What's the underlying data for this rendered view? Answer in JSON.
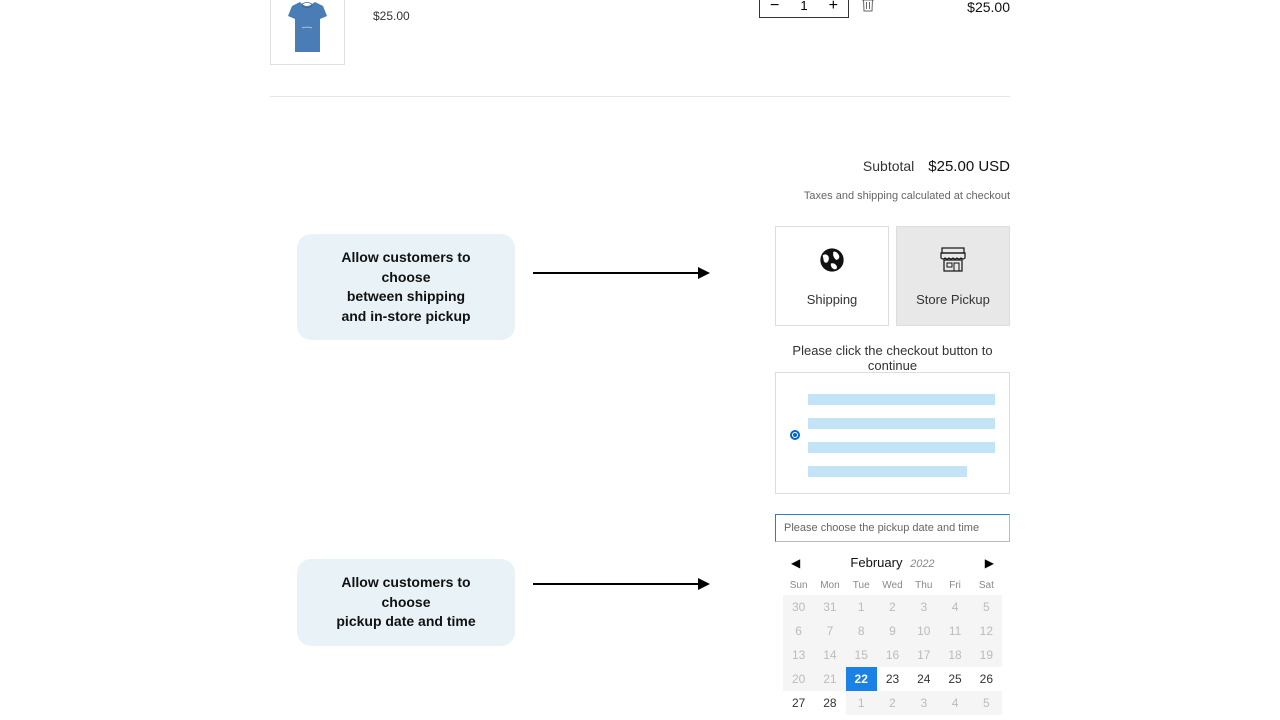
{
  "cart": {
    "item_price": "$25.00",
    "qty_minus": "−",
    "qty_value": "1",
    "qty_plus": "+",
    "line_total": "$25.00"
  },
  "summary": {
    "subtotal_label": "Subtotal",
    "subtotal_value": "$25.00 USD",
    "tax_note": "Taxes and shipping calculated at checkout"
  },
  "callouts": {
    "one_l1": "Allow customers to choose",
    "one_l2": "between shipping",
    "one_l3": "and in-store pickup",
    "two_l1": "Allow customers to choose",
    "two_l2": "pickup date and time"
  },
  "delivery": {
    "shipping_label": "Shipping",
    "pickup_label": "Store Pickup",
    "checkout_hint": "Please click the checkout button to continue"
  },
  "datepicker": {
    "placeholder": "Please choose the pickup date and time",
    "month": "February",
    "year": "2022",
    "dows": [
      "Sun",
      "Mon",
      "Tue",
      "Wed",
      "Thu",
      "Fri",
      "Sat"
    ],
    "days": [
      {
        "n": "30",
        "muted": true
      },
      {
        "n": "31",
        "muted": true
      },
      {
        "n": "1",
        "muted": true
      },
      {
        "n": "2",
        "muted": true
      },
      {
        "n": "3",
        "muted": true
      },
      {
        "n": "4",
        "muted": true
      },
      {
        "n": "5",
        "muted": true
      },
      {
        "n": "6",
        "muted": true
      },
      {
        "n": "7",
        "muted": true
      },
      {
        "n": "8",
        "muted": true
      },
      {
        "n": "9",
        "muted": true
      },
      {
        "n": "10",
        "muted": true
      },
      {
        "n": "11",
        "muted": true
      },
      {
        "n": "12",
        "muted": true
      },
      {
        "n": "13",
        "muted": true
      },
      {
        "n": "14",
        "muted": true
      },
      {
        "n": "15",
        "muted": true
      },
      {
        "n": "16",
        "muted": true
      },
      {
        "n": "17",
        "muted": true
      },
      {
        "n": "18",
        "muted": true
      },
      {
        "n": "19",
        "muted": true
      },
      {
        "n": "20",
        "muted": true
      },
      {
        "n": "21",
        "muted": true
      },
      {
        "n": "22",
        "selected": true
      },
      {
        "n": "23"
      },
      {
        "n": "24"
      },
      {
        "n": "25"
      },
      {
        "n": "26"
      },
      {
        "n": "27"
      },
      {
        "n": "28"
      },
      {
        "n": "1",
        "muted": true
      },
      {
        "n": "2",
        "muted": true
      },
      {
        "n": "3",
        "muted": true
      },
      {
        "n": "4",
        "muted": true
      },
      {
        "n": "5",
        "muted": true
      }
    ]
  }
}
